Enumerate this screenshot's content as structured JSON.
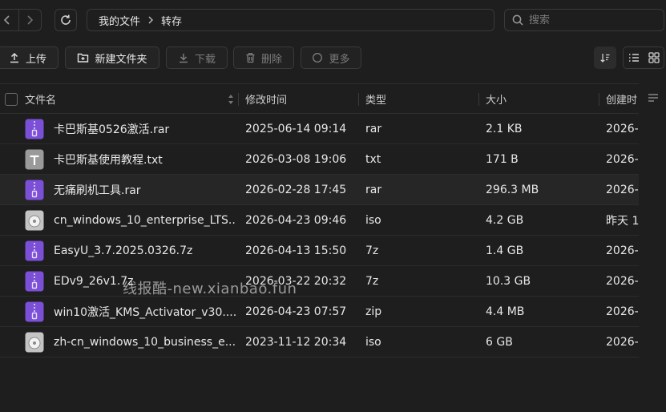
{
  "breadcrumb": {
    "root": "我的文件",
    "current": "转存"
  },
  "search": {
    "placeholder": "搜索"
  },
  "toolbar": {
    "upload": "上传",
    "new_folder": "新建文件夹",
    "download": "下载",
    "delete": "删除",
    "more": "更多"
  },
  "table": {
    "headers": {
      "name": "文件名",
      "modified": "修改时间",
      "type": "类型",
      "size": "大小",
      "created": "创建时"
    },
    "rows": [
      {
        "name": "卡巴斯基0526激活.rar",
        "modified": "2025-06-14 09:14",
        "type": "rar",
        "size": "2.1 KB",
        "created": "2026-",
        "icon": "archive-icon"
      },
      {
        "name": "卡巴斯基使用教程.txt",
        "modified": "2026-03-08 19:06",
        "type": "txt",
        "size": "171 B",
        "created": "2026-",
        "icon": "text-file-icon"
      },
      {
        "name": "无痛刷机工具.rar",
        "modified": "2026-02-28 17:45",
        "type": "rar",
        "size": "296.3 MB",
        "created": "2026-",
        "icon": "archive-icon"
      },
      {
        "name": "cn_windows_10_enterprise_LTS...",
        "modified": "2026-04-23 09:46",
        "type": "iso",
        "size": "4.2 GB",
        "created": "昨天 1",
        "icon": "disc-image-icon"
      },
      {
        "name": "EasyU_3.7.2025.0326.7z",
        "modified": "2026-04-13 15:50",
        "type": "7z",
        "size": "1.4 GB",
        "created": "2026-",
        "icon": "archive-icon"
      },
      {
        "name": "EDv9_26v1.7z",
        "modified": "2026-03-22 20:32",
        "type": "7z",
        "size": "10.3 GB",
        "created": "2026-",
        "icon": "archive-icon"
      },
      {
        "name": "win10激活_KMS_Activator_v30....",
        "modified": "2026-04-23 07:57",
        "type": "zip",
        "size": "4.4 MB",
        "created": "2026-",
        "icon": "archive-icon"
      },
      {
        "name": "zh-cn_windows_10_business_e...",
        "modified": "2023-11-12 20:34",
        "type": "iso",
        "size": "6 GB",
        "created": "2026-",
        "icon": "disc-image-icon"
      }
    ]
  },
  "watermark": "线报酷-new.xianbao.fun",
  "colors": {
    "background": "#1e1e1e",
    "archive": "#7b4fd6",
    "text_icon": "#9a9a9a",
    "border": "#3a3a3a"
  }
}
